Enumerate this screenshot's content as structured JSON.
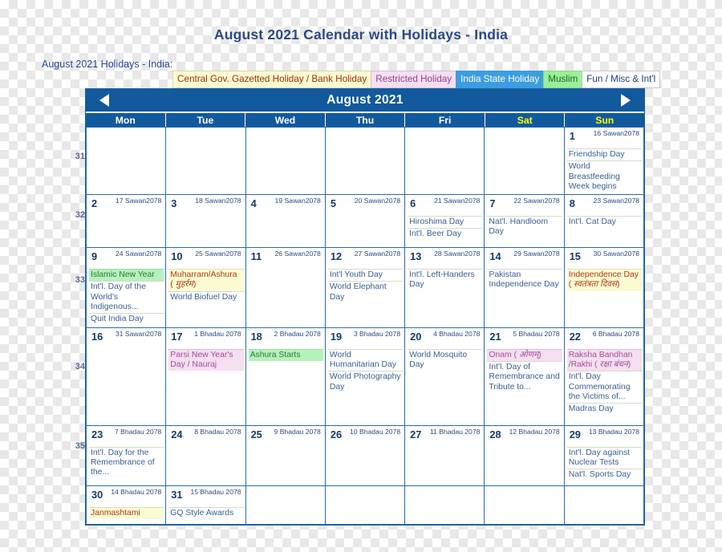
{
  "page": {
    "title": "August 2021 Calendar with Holidays - India",
    "legend_label": "August 2021 Holidays - India:"
  },
  "legend": [
    {
      "label": "Central Gov. Gazetted Holiday / Bank Holiday",
      "key": "gazetted",
      "bg": "#fbfbd4",
      "fg": "#a03000"
    },
    {
      "label": "Restricted Holiday",
      "key": "restricted",
      "bg": "#f5dff1",
      "fg": "#9b3f8d"
    },
    {
      "label": "India State Holiday",
      "key": "state",
      "bg": "#3c9de0",
      "fg": "#ffffff"
    },
    {
      "label": "Muslim",
      "key": "muslim",
      "bg": "#9af09a",
      "fg": "#1a6b1a"
    },
    {
      "label": "Fun / Misc & Int'l",
      "key": "fun",
      "bg": "#ffffff",
      "fg": "#1c3f7a"
    }
  ],
  "calendar": {
    "month_title": "August 2021",
    "prev_icon": "triangle-left-icon",
    "next_icon": "triangle-right-icon",
    "weekdays": [
      {
        "label": "Mon",
        "weekend": false
      },
      {
        "label": "Tue",
        "weekend": false
      },
      {
        "label": "Wed",
        "weekend": false
      },
      {
        "label": "Thu",
        "weekend": false
      },
      {
        "label": "Fri",
        "weekend": false
      },
      {
        "label": "Sat",
        "weekend": true
      },
      {
        "label": "Sun",
        "weekend": true
      }
    ],
    "week_numbers": [
      "31",
      "32",
      "33",
      "34",
      "35"
    ],
    "weeks": [
      {
        "number": "31",
        "days": [
          {
            "pad": true
          },
          {
            "pad": true
          },
          {
            "pad": true
          },
          {
            "pad": true
          },
          {
            "pad": true
          },
          {
            "pad": true
          },
          {
            "day": "1",
            "alt": "16 Sawan2078",
            "weekend": true,
            "events": [
              {
                "text": "Friendship Day",
                "style": "plain"
              },
              {
                "text": "World Breastfeeding Week begins",
                "style": "plain"
              }
            ]
          }
        ]
      },
      {
        "number": "32",
        "days": [
          {
            "day": "2",
            "alt": "17 Sawan2078",
            "events": []
          },
          {
            "day": "3",
            "alt": "18 Sawan2078",
            "events": []
          },
          {
            "day": "4",
            "alt": "19 Sawan2078",
            "events": []
          },
          {
            "day": "5",
            "alt": "20 Sawan2078",
            "events": []
          },
          {
            "day": "6",
            "alt": "21 Sawan2078",
            "events": [
              {
                "text": "Hiroshima Day",
                "style": "plain"
              },
              {
                "text": "Int'l. Beer Day",
                "style": "plain"
              }
            ]
          },
          {
            "day": "7",
            "alt": "22 Sawan2078",
            "weekend": true,
            "events": [
              {
                "text": "Nat'l. Handloom Day",
                "style": "plain"
              }
            ]
          },
          {
            "day": "8",
            "alt": "23 Sawan2078",
            "weekend": true,
            "events": [
              {
                "text": "Int'l. Cat Day",
                "style": "plain"
              }
            ]
          }
        ]
      },
      {
        "number": "33",
        "days": [
          {
            "day": "9",
            "alt": "24 Sawan2078",
            "events": [
              {
                "text": "Islamic New Year",
                "style": "muslim"
              },
              {
                "text": "Int'l. Day of the World's Indigenous...",
                "style": "plain"
              },
              {
                "text": "Quit India Day",
                "style": "plain"
              }
            ]
          },
          {
            "day": "10",
            "alt": "25 Sawan2078",
            "events": [
              {
                "text": "Muharram/Ashura ( ",
                "devanagari": "मुहर्रम",
                "text_after": ")",
                "style": "gazetted"
              },
              {
                "text": "World Biofuel Day",
                "style": "plain"
              }
            ]
          },
          {
            "day": "11",
            "alt": "26 Sawan2078",
            "events": []
          },
          {
            "day": "12",
            "alt": "27 Sawan2078",
            "events": [
              {
                "text": "Int'l Youth Day",
                "style": "plain"
              },
              {
                "text": "World Elephant Day",
                "style": "plain"
              }
            ]
          },
          {
            "day": "13",
            "alt": "28 Sawan2078",
            "events": [
              {
                "text": "Int'l. Left-Handers Day",
                "style": "plain"
              }
            ]
          },
          {
            "day": "14",
            "alt": "29 Sawan2078",
            "weekend": true,
            "events": [
              {
                "text": "Pakistan Independence Day",
                "style": "plain"
              }
            ]
          },
          {
            "day": "15",
            "alt": "30 Sawan2078",
            "weekend": true,
            "events": [
              {
                "text": "Independence Day ( ",
                "devanagari": "स्वतंत्रता दिवस",
                "text_after": ")",
                "style": "gazetted"
              }
            ]
          }
        ]
      },
      {
        "number": "34",
        "days": [
          {
            "day": "16",
            "alt": "31 Sawan2078",
            "events": []
          },
          {
            "day": "17",
            "alt": "1 Bhadau 2078",
            "events": [
              {
                "text": "Parsi New Year's Day / Nauraj",
                "style": "restricted"
              }
            ]
          },
          {
            "day": "18",
            "alt": "2 Bhadau 2078",
            "events": [
              {
                "text": "Ashura Starts",
                "style": "muslim"
              }
            ]
          },
          {
            "day": "19",
            "alt": "3 Bhadau 2078",
            "events": [
              {
                "text": "World Humanitarian Day",
                "style": "plain"
              },
              {
                "text": "World Photography Day",
                "style": "plain"
              }
            ]
          },
          {
            "day": "20",
            "alt": "4 Bhadau 2078",
            "events": [
              {
                "text": "World Mosquito Day",
                "style": "plain"
              }
            ]
          },
          {
            "day": "21",
            "alt": "5 Bhadau 2078",
            "weekend": true,
            "events": [
              {
                "text": "Onam ( ",
                "devanagari": "ओणम्",
                "text_after": ")",
                "style": "restricted"
              },
              {
                "text": "Int'l. Day of Remembrance and Tribute to...",
                "style": "plain"
              }
            ]
          },
          {
            "day": "22",
            "alt": "6 Bhadau 2078",
            "weekend": true,
            "events": [
              {
                "text": "Raksha Bandhan /Rakhi ( ",
                "devanagari": "रक्षा बंधन",
                "text_after": ")",
                "style": "restricted"
              },
              {
                "text": "Int'l. Day Commemorating the Victims of...",
                "style": "plain"
              },
              {
                "text": "Madras Day",
                "style": "plain"
              }
            ]
          }
        ]
      },
      {
        "number": "35",
        "days": [
          {
            "day": "23",
            "alt": "7 Bhadau 2078",
            "events": [
              {
                "text": "Int'l. Day for the Remembrance of the...",
                "style": "plain"
              }
            ]
          },
          {
            "day": "24",
            "alt": "8 Bhadau 2078",
            "events": []
          },
          {
            "day": "25",
            "alt": "9 Bhadau 2078",
            "events": []
          },
          {
            "day": "26",
            "alt": "10 Bhadau 2078",
            "events": []
          },
          {
            "day": "27",
            "alt": "11 Bhadau 2078",
            "events": []
          },
          {
            "day": "28",
            "alt": "12 Bhadau 2078",
            "weekend": true,
            "events": []
          },
          {
            "day": "29",
            "alt": "13 Bhadau 2078",
            "weekend": true,
            "events": [
              {
                "text": "Int'l. Day against Nuclear Tests",
                "style": "plain"
              },
              {
                "text": "Nat'l. Sports Day",
                "style": "plain"
              }
            ]
          }
        ]
      },
      {
        "number": "",
        "days": [
          {
            "day": "30",
            "alt": "14 Bhadau 2078",
            "events": [
              {
                "text": "Janmashtami",
                "style": "gazetted"
              }
            ]
          },
          {
            "day": "31",
            "alt": "15 Bhadau 2078",
            "events": [
              {
                "text": "GQ Style Awards",
                "style": "plain"
              }
            ]
          },
          {
            "pad": true
          },
          {
            "pad": true
          },
          {
            "pad": true
          },
          {
            "pad": true
          },
          {
            "pad": true
          }
        ]
      }
    ]
  }
}
